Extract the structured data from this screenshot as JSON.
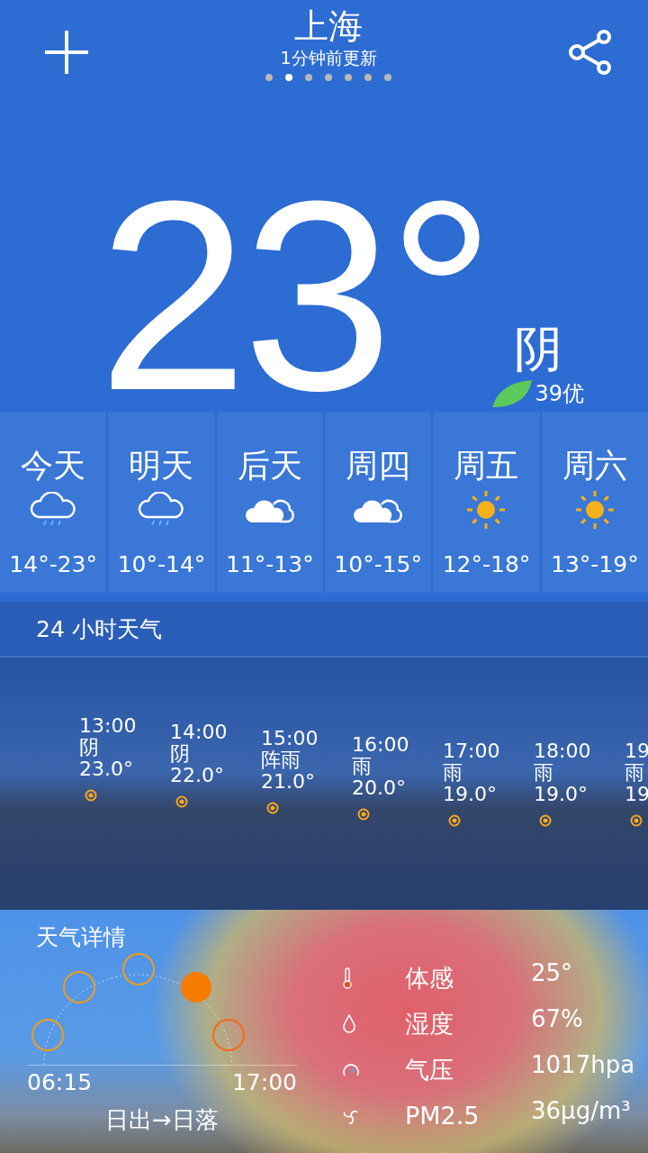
{
  "header": {
    "city": "上海",
    "updated": "1分钟前更新",
    "pages": [
      {
        "selected": false
      },
      {
        "selected": true
      },
      {
        "selected": false
      },
      {
        "selected": false
      },
      {
        "selected": false
      },
      {
        "selected": false
      },
      {
        "selected": false
      }
    ]
  },
  "current": {
    "temperature": "23°",
    "condition": "阴",
    "aqi": "39优"
  },
  "forecast": [
    {
      "day": "今天",
      "kind": "rain",
      "range": "14°-23°"
    },
    {
      "day": "明天",
      "kind": "rain",
      "range": "10°-14°"
    },
    {
      "day": "后天",
      "kind": "cloud",
      "range": "11°-13°"
    },
    {
      "day": "周四",
      "kind": "cloud",
      "range": "10°-15°"
    },
    {
      "day": "周五",
      "kind": "sun",
      "range": "12°-18°"
    },
    {
      "day": "周六",
      "kind": "sun",
      "range": "13°-19°"
    }
  ],
  "hourly": {
    "title": "24 小时天气",
    "items": [
      {
        "time": "13:00",
        "condition": "阴",
        "temp": "23.0°"
      },
      {
        "time": "14:00",
        "condition": "阴",
        "temp": "22.0°"
      },
      {
        "time": "15:00",
        "condition": "阵雨",
        "temp": "21.0°"
      },
      {
        "time": "16:00",
        "condition": "雨",
        "temp": "20.0°"
      },
      {
        "time": "17:00",
        "condition": "雨",
        "temp": "19.0°"
      },
      {
        "time": "18:00",
        "condition": "雨",
        "temp": "19.0°"
      },
      {
        "time": "19",
        "condition": "雨",
        "temp": "19"
      }
    ]
  },
  "details": {
    "title": "天气详情",
    "sunrise": "06:15",
    "sunset": "17:00",
    "caption": "日出→日落",
    "rows": [
      {
        "kind": "thermometer",
        "label": "体感",
        "value": "25°"
      },
      {
        "kind": "humidity",
        "label": "湿度",
        "value": "67%"
      },
      {
        "kind": "pressure",
        "label": "气压",
        "value": "1017hpa"
      },
      {
        "kind": "wind",
        "label": "PM2.5",
        "value": "36μg/m³"
      }
    ]
  }
}
